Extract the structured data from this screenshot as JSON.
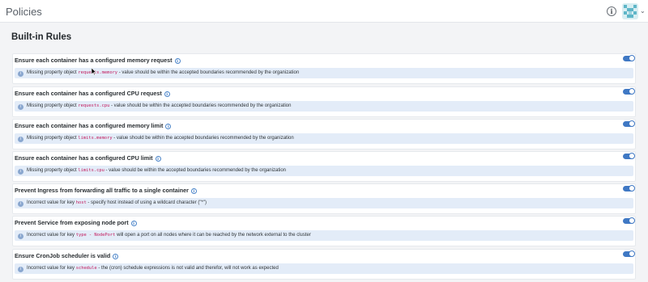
{
  "header": {
    "title": "Policies",
    "info_icon": "info-icon",
    "avatar_icon": "avatar-pixel-icon",
    "chevron_icon": "chevron-down-icon"
  },
  "section": {
    "title": "Built-in Rules"
  },
  "colors": {
    "accent": "#3f78c4",
    "detail_bg": "#e3ecf8",
    "code": "#c2185b"
  },
  "rules": [
    {
      "title": "Ensure each container has a configured memory request",
      "enabled": true,
      "detail": {
        "prefix": "Missing property object",
        "code": "requests.memory",
        "suffix": "- value should be within the accepted boundaries recommended by the organization"
      }
    },
    {
      "title": "Ensure each container has a configured CPU request",
      "enabled": true,
      "detail": {
        "prefix": "Missing property object",
        "code": "requests.cpu",
        "suffix": "- value should be within the accepted boundaries recommended by the organization"
      }
    },
    {
      "title": "Ensure each container has a configured memory limit",
      "enabled": true,
      "detail": {
        "prefix": "Missing property object",
        "code": "limits.memory",
        "suffix": "- value should be within the accepted boundaries recommended by the organization"
      }
    },
    {
      "title": "Ensure each container has a configured CPU limit",
      "enabled": true,
      "detail": {
        "prefix": "Missing property object",
        "code": "limits.cpu",
        "suffix": "- value should be within the accepted boundaries recommended by the organization"
      }
    },
    {
      "title": "Prevent Ingress from forwarding all traffic to a single container",
      "enabled": true,
      "detail": {
        "prefix": "Incorrect value for key",
        "code": "host",
        "suffix": "- specify host instead of using a wildcard character (\"*\")"
      }
    },
    {
      "title": "Prevent Service from exposing node port",
      "enabled": true,
      "detail": {
        "prefix": "Incorrect value for key",
        "code": "type - NodePort",
        "suffix": "will open a port on all nodes where it can be reached by the network external to the cluster"
      }
    },
    {
      "title": "Ensure CronJob scheduler is valid",
      "enabled": true,
      "detail": {
        "prefix": "Incorrect value for key",
        "code": "schedule",
        "suffix": "- the (cron) schedule expressions is not valid and therefor, will not work as expected"
      }
    }
  ]
}
